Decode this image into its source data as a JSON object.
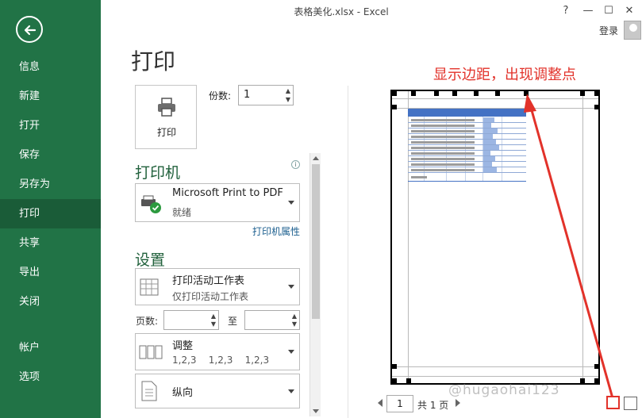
{
  "app": {
    "title": "表格美化.xlsx - Excel"
  },
  "window": {
    "help": "?",
    "minimize": "—",
    "restore": "☐",
    "close": "✕",
    "login": "登录"
  },
  "nav": {
    "items": [
      {
        "label": "信息"
      },
      {
        "label": "新建"
      },
      {
        "label": "打开"
      },
      {
        "label": "保存"
      },
      {
        "label": "另存为"
      },
      {
        "label": "打印",
        "active": true
      },
      {
        "label": "共享"
      },
      {
        "label": "导出"
      },
      {
        "label": "关闭"
      },
      {
        "label": "帐户"
      },
      {
        "label": "选项"
      }
    ]
  },
  "print": {
    "heading": "打印",
    "button": "打印",
    "copies_label": "份数:",
    "copies_value": "1",
    "printer_heading": "打印机",
    "printer_name": "Microsoft Print to PDF",
    "printer_status": "就绪",
    "printer_props": "打印机属性",
    "settings_heading": "设置",
    "scope_title": "打印活动工作表",
    "scope_desc": "仅打印活动工作表",
    "pages_label": "页数:",
    "to_label": "至",
    "collate_title": "调整",
    "collate_desc": "1,2,3    1,2,3    1,2,3",
    "orientation": "纵向"
  },
  "preview": {
    "annotation": "显示边距，出现调整点",
    "page_current": "1",
    "page_total": "共 1 页",
    "watermark": "@hugaohai123"
  },
  "colors": {
    "accent": "#217346",
    "annotation": "#e2322a"
  },
  "icons": [
    "back-arrow-icon",
    "printer-icon",
    "printer-ready-icon",
    "sheet-icon",
    "collate-icon",
    "portrait-icon",
    "info-icon",
    "show-margins-icon",
    "zoom-to-page-icon"
  ]
}
